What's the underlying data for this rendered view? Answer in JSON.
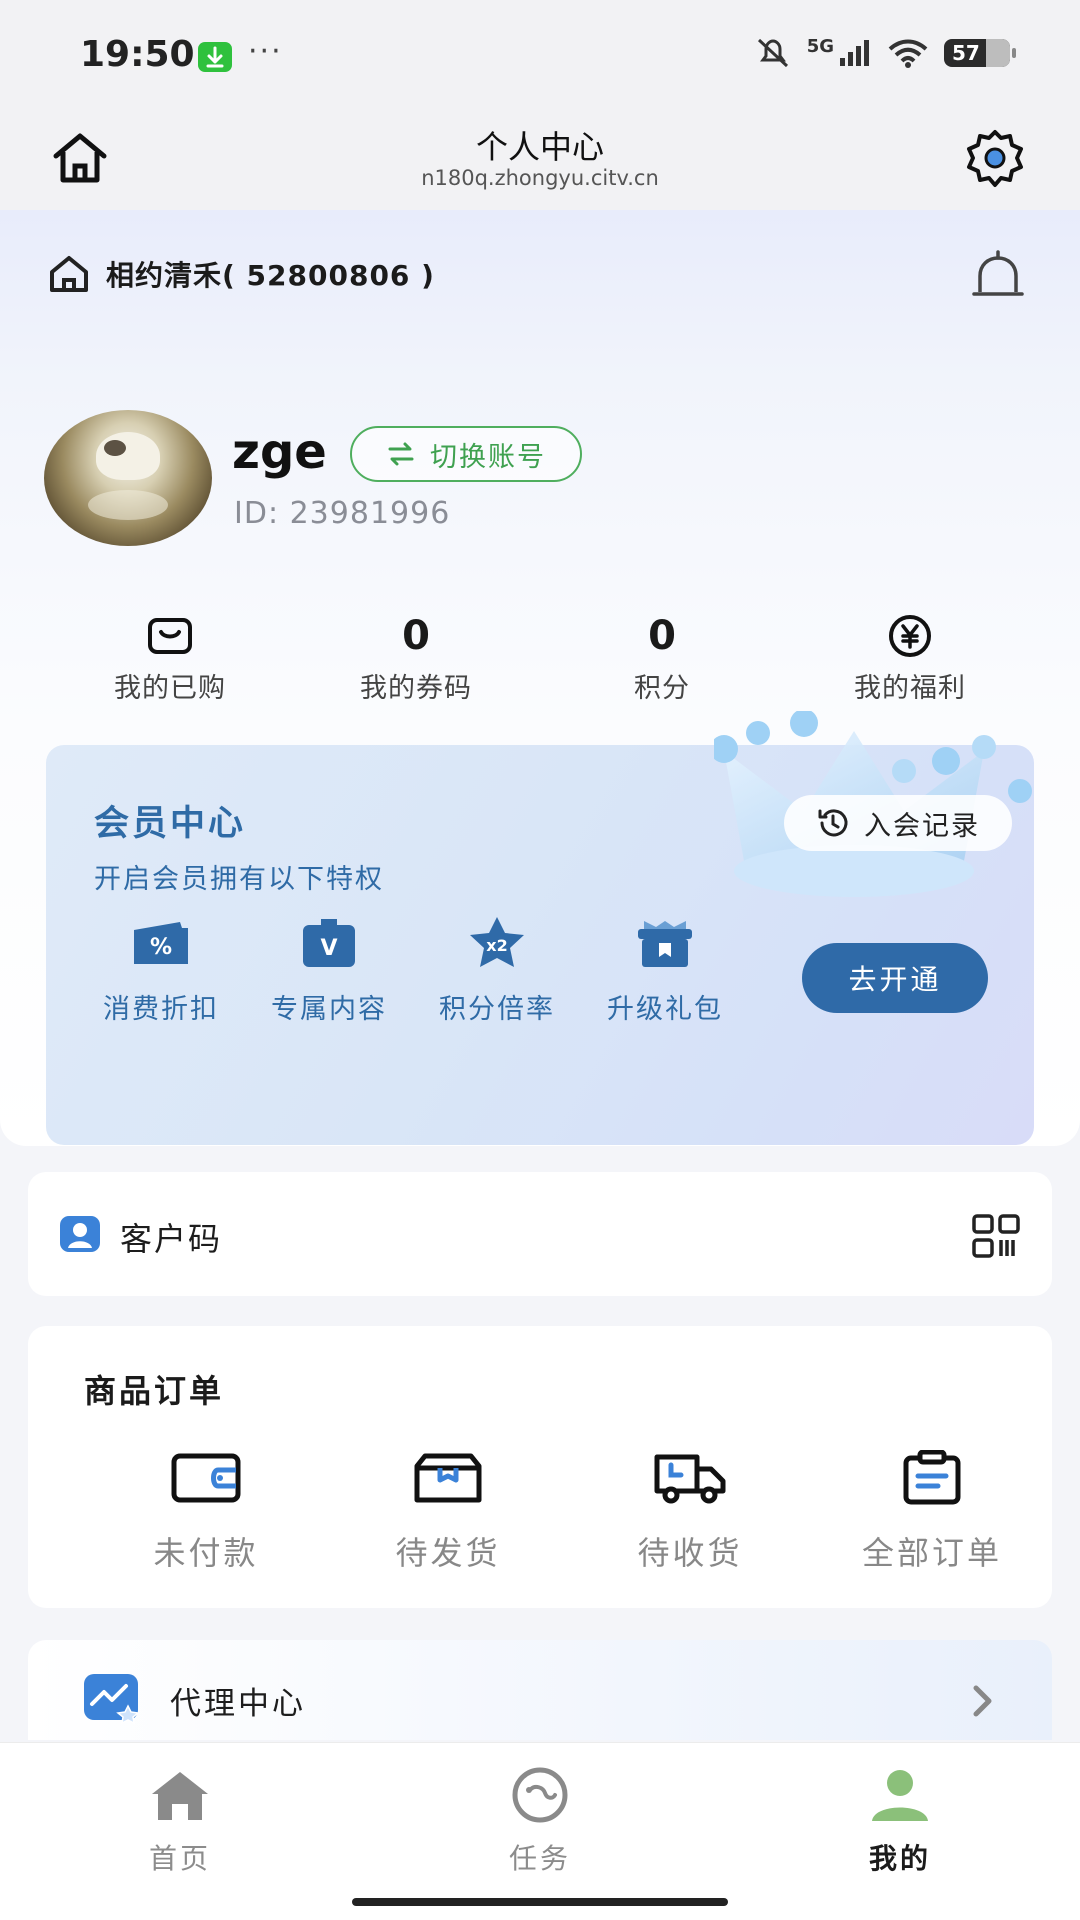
{
  "status_bar": {
    "time": "19:50",
    "dots": "···",
    "network": "5G",
    "battery": "57"
  },
  "header": {
    "title": "个人中心",
    "url": "n180q.zhongyu.citv.cn"
  },
  "shop": {
    "name": "相约清禾( 52800806 )"
  },
  "user": {
    "name": "zge",
    "switch_label": "切换账号",
    "id": "ID: 23981996"
  },
  "stats": [
    {
      "label": "我的已购",
      "icon": "purchased-icon"
    },
    {
      "value": "0",
      "label": "我的券码"
    },
    {
      "value": "0",
      "label": "积分"
    },
    {
      "label": "我的福利",
      "icon": "yen-coin-icon"
    }
  ],
  "membership": {
    "title": "会员中心",
    "subtitle": "开启会员拥有以下特权",
    "record_label": "入会记录",
    "open_label": "去开通",
    "perks": [
      {
        "label": "消费折扣",
        "icon": "discount-icon",
        "glyph": "%"
      },
      {
        "label": "专属内容",
        "icon": "exclusive-icon",
        "glyph": "V"
      },
      {
        "label": "积分倍率",
        "icon": "points-multiplier-icon",
        "glyph": "x2"
      },
      {
        "label": "升级礼包",
        "icon": "gift-icon"
      }
    ]
  },
  "customer_code": {
    "label": "客户码"
  },
  "orders": {
    "title": "商品订单",
    "items": [
      {
        "label": "未付款",
        "icon": "wallet-icon"
      },
      {
        "label": "待发货",
        "icon": "box-icon"
      },
      {
        "label": "待收货",
        "icon": "truck-icon"
      },
      {
        "label": "全部订单",
        "icon": "clipboard-icon"
      }
    ]
  },
  "agent": {
    "label": "代理中心"
  },
  "tabbar": {
    "items": [
      {
        "label": "首页",
        "icon": "home-icon"
      },
      {
        "label": "任务",
        "icon": "task-icon"
      },
      {
        "label": "我的",
        "icon": "profile-icon",
        "active": true
      }
    ]
  },
  "colors": {
    "accent_blue": "#2f6aa8",
    "member_text": "#2f6ba6",
    "switch_green": "#3fa150",
    "active_tab_icon": "#8bc07a"
  }
}
